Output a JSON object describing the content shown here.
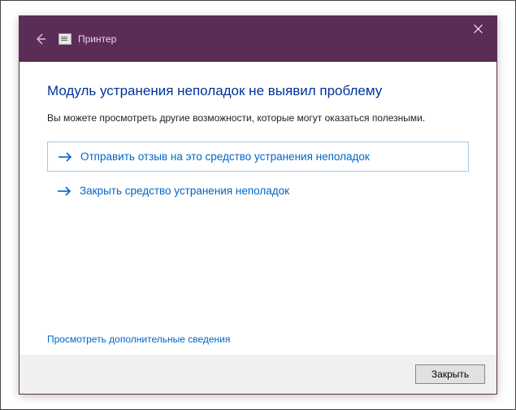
{
  "titlebar": {
    "title": "Принтер"
  },
  "main": {
    "heading": "Модуль устранения неполадок не выявил проблему",
    "subtext": "Вы можете просмотреть другие возможности, которые могут оказаться полезными.",
    "options": {
      "feedback": "Отправить отзыв на это средство устранения неполадок",
      "close_tool": "Закрыть средство устранения неполадок"
    },
    "more_link": "Просмотреть дополнительные сведения"
  },
  "footer": {
    "close_button": "Закрыть"
  }
}
